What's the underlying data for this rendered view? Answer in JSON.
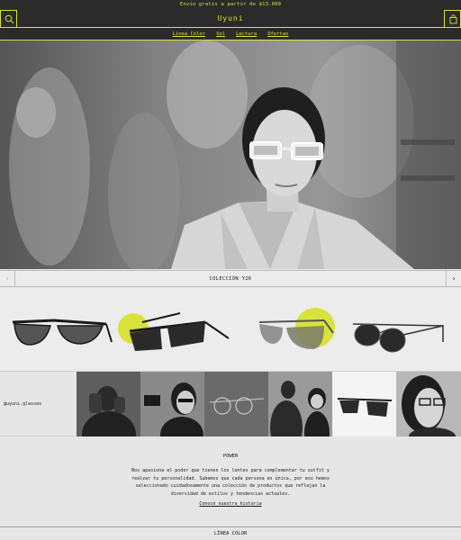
{
  "announcement": "Envío gratis a partir de $13.000",
  "header": {
    "brand": "Uyuni",
    "search_icon": "search-icon",
    "cart_icon": "bag-icon"
  },
  "nav": [
    "Línea Color",
    "Sol",
    "Lectura",
    "Ofertas"
  ],
  "carousel": {
    "title": "COLECCIÓN Y2K",
    "prev_icon": "chevron-left-icon",
    "next_icon": "chevron-right-icon"
  },
  "instagram": {
    "handle": "@uyuni.glasses"
  },
  "about": {
    "heading": "POWER",
    "body": "Nos apasiona el poder que tienen los lentes para complementar tu outfit y realzar tu personalidad. Sabemos que cada persona es única, por eso hemos seleccionado cuidadosamente una colección de productos que reflejan la diversidad de estilos y tendencias actuales.",
    "link": "Conocé nuestra historia"
  },
  "footer_section": "LÍNEA COLOR",
  "colors": {
    "accent": "#d9e23a",
    "dark": "#2b2b2b",
    "light": "#e6e6e6"
  }
}
